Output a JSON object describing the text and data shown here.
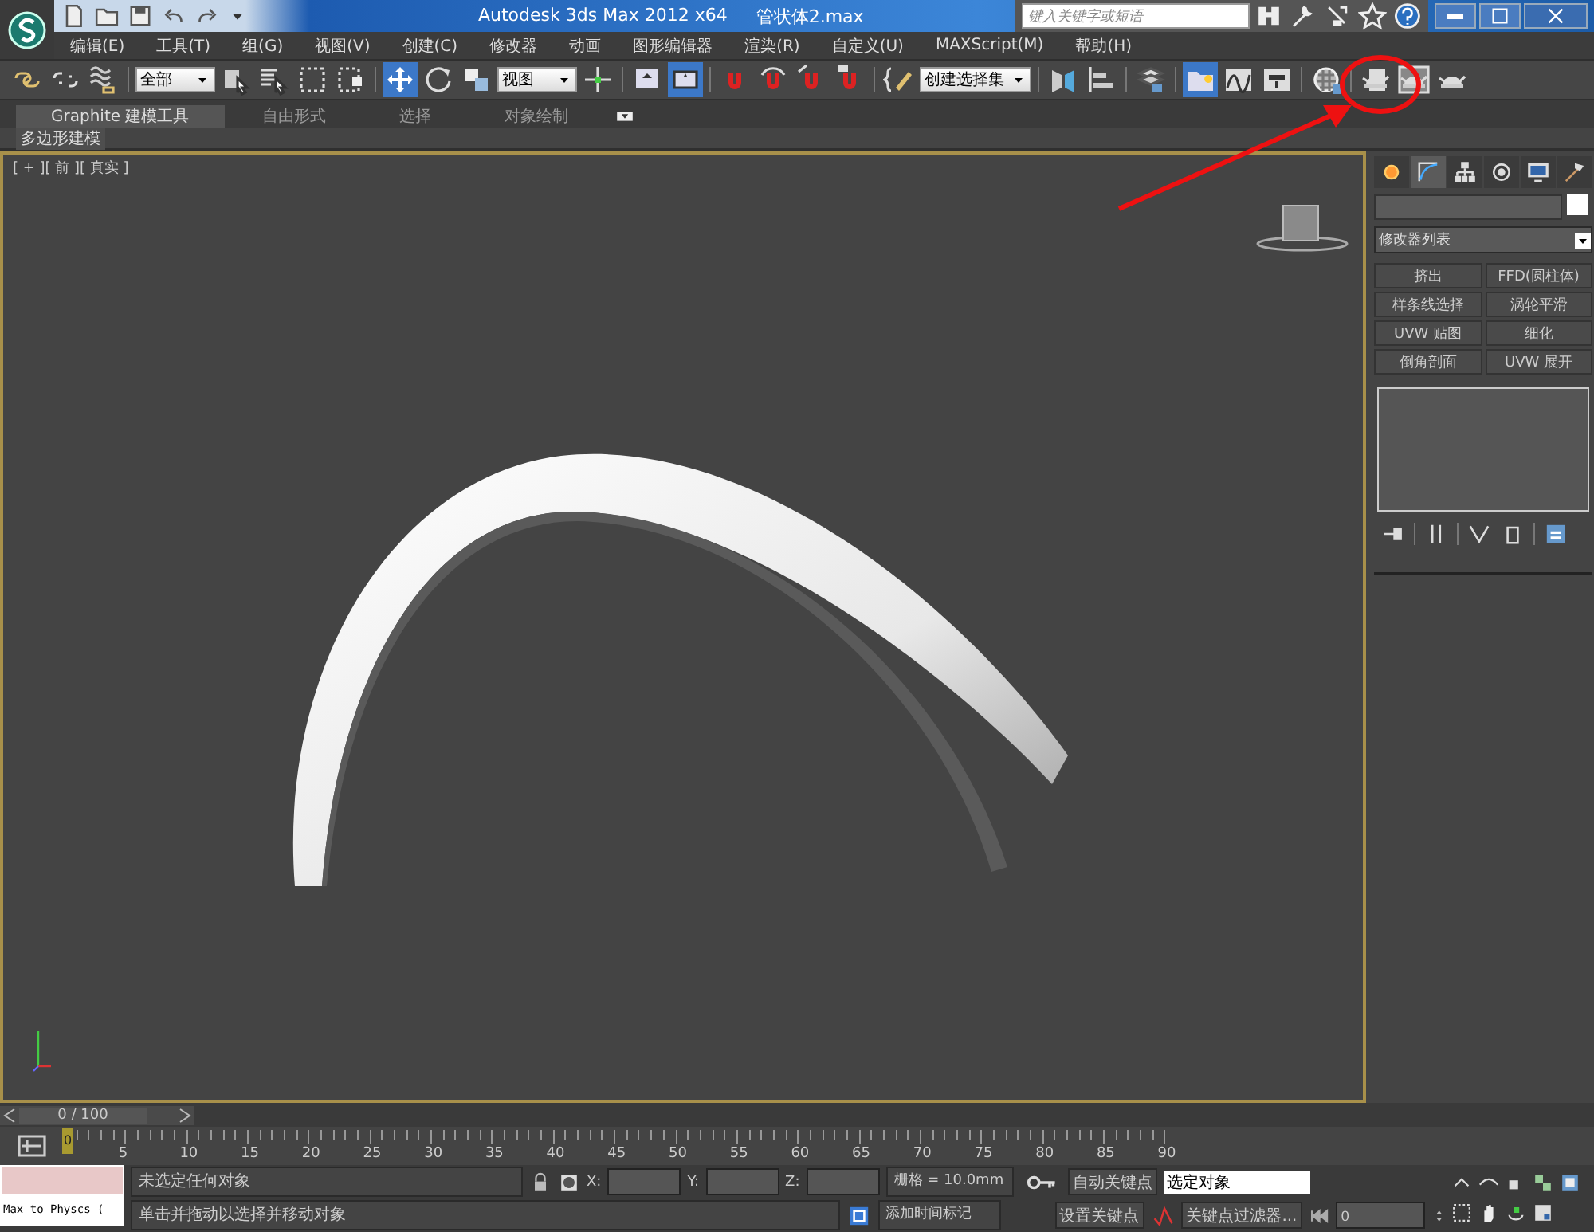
{
  "title_bar": {
    "app": "Autodesk 3ds Max  2012 x64",
    "file": "管状体2.max",
    "search": {
      "placeholder": "键入关键字或短语"
    }
  },
  "menu": [
    "编辑(E)",
    "工具(T)",
    "组(G)",
    "视图(V)",
    "创建(C)",
    "修改器",
    "动画",
    "图形编辑器",
    "渲染(R)",
    "自定义(U)",
    "MAXScript(M)",
    "帮助(H)"
  ],
  "toolbar": [
    {
      "kind": "button",
      "selected": false
    },
    {
      "kind": "button",
      "selected": false
    },
    {
      "kind": "button",
      "selected": false
    },
    {
      "kind": "separator"
    },
    {
      "kind": "dropdown",
      "value": "全部"
    },
    {
      "kind": "button",
      "selected": false
    },
    {
      "kind": "button",
      "selected": false
    },
    {
      "kind": "button",
      "selected": false
    },
    {
      "kind": "button",
      "selected": false
    },
    {
      "kind": "separator"
    },
    {
      "kind": "button",
      "selected": true
    },
    {
      "kind": "button",
      "selected": false
    },
    {
      "kind": "button",
      "selected": false
    },
    {
      "kind": "dropdown",
      "value": "视图"
    },
    {
      "kind": "button",
      "selected": false
    },
    {
      "kind": "separator"
    },
    {
      "kind": "button",
      "selected": false
    },
    {
      "kind": "button",
      "selected": true
    },
    {
      "kind": "separator"
    },
    {
      "kind": "button",
      "selected": false
    },
    {
      "kind": "button",
      "selected": false
    },
    {
      "kind": "button",
      "selected": false
    },
    {
      "kind": "button",
      "selected": false
    },
    {
      "kind": "separator"
    },
    {
      "kind": "button",
      "selected": false
    },
    {
      "kind": "dropdown",
      "value": "创建选择集"
    },
    {
      "kind": "separator"
    },
    {
      "kind": "button",
      "selected": false
    },
    {
      "kind": "button",
      "selected": false
    },
    {
      "kind": "separator"
    },
    {
      "kind": "button",
      "selected": false
    },
    {
      "kind": "separator"
    },
    {
      "kind": "button",
      "selected": true
    },
    {
      "kind": "button",
      "selected": false
    },
    {
      "kind": "button",
      "selected": false
    },
    {
      "kind": "separator"
    },
    {
      "kind": "button",
      "selected": false
    },
    {
      "kind": "separator"
    },
    {
      "kind": "button",
      "selected": false
    },
    {
      "kind": "button",
      "selected": false
    },
    {
      "kind": "button",
      "selected": false
    }
  ],
  "ribbon": {
    "tabs": [
      {
        "label": "Graphite 建模工具",
        "selected": true
      },
      {
        "label": "自由形式",
        "selected": false
      },
      {
        "label": "选择",
        "selected": false
      },
      {
        "label": "对象绘制",
        "selected": false
      }
    ],
    "panel": "多边形建模"
  },
  "viewport": {
    "label": "[ + ][ 前 ][ 真实 ]",
    "active": true
  },
  "command_panel": {
    "tabs": [
      {
        "selected": false
      },
      {
        "selected": true
      },
      {
        "selected": false
      },
      {
        "selected": false
      },
      {
        "selected": false
      },
      {
        "selected": false
      }
    ],
    "modifier_list": "修改器列表",
    "buttons": [
      "挤出",
      "FFD(圆柱体)",
      "样条线选择",
      "涡轮平滑",
      "UVW 贴图",
      "细化",
      "倒角剖面",
      "UVW 展开"
    ]
  },
  "time_slider": {
    "label": "0 / 100"
  },
  "track_bar": {
    "current_frame": "0",
    "labels": [
      "5",
      "10",
      "15",
      "20",
      "25",
      "30",
      "35",
      "40",
      "45",
      "50",
      "55",
      "60",
      "65",
      "70",
      "75",
      "80",
      "85",
      "90"
    ]
  },
  "status": {
    "listener": "Max to Physcs (",
    "selection": "未选定任何对象",
    "prompt": "单击并拖动以选择并移动对象",
    "x": "X:",
    "y": "Y:",
    "z": "Z:",
    "grid": "栅格 = 10.0mm",
    "add_time_tag": "添加时间标记",
    "auto_key": "自动关键点",
    "set_key": "设置关键点",
    "key_mode": "选定对象",
    "key_filters": "关键点过滤器...",
    "frame": "0"
  }
}
